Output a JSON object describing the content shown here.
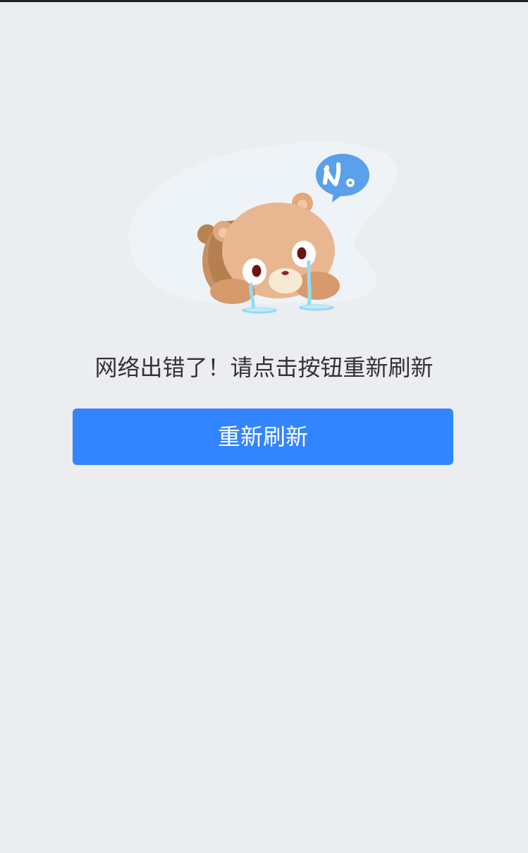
{
  "status_bar": {
    "color": "#1f2328"
  },
  "illustration": {
    "icon": "crying-bear-icon",
    "speech_bubble_text": "No",
    "bubble_color": "#5aa0ea"
  },
  "error": {
    "message": "网络出错了！请点击按钮重新刷新"
  },
  "button": {
    "label": "重新刷新",
    "color": "#3385ff"
  },
  "page": {
    "background": "#ebedf0"
  }
}
